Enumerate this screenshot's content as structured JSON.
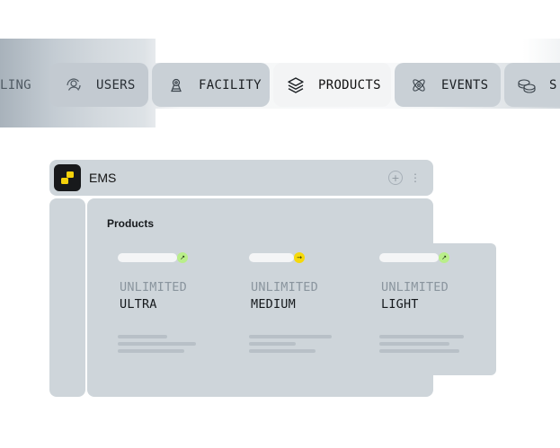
{
  "tabs": [
    {
      "key": "billing",
      "label": "LING",
      "icon": "partial-icon"
    },
    {
      "key": "users",
      "label": "USERS",
      "icon": "users-icon"
    },
    {
      "key": "facility",
      "label": "FACILITY",
      "icon": "facility-icon"
    },
    {
      "key": "products",
      "label": "PRODUCTS",
      "icon": "layers-icon",
      "active": true
    },
    {
      "key": "events",
      "label": "EVENTS",
      "icon": "atom-icon"
    },
    {
      "key": "settings",
      "label": "S",
      "icon": "coins-icon"
    }
  ],
  "app": {
    "title": "EMS",
    "logo": "ems-logo",
    "section_title": "Products"
  },
  "products": [
    {
      "kind": "UNLIMITED",
      "name": "ULTRA",
      "status_color": "#b9ee8a",
      "status_icon": "arrow-up-right-icon"
    },
    {
      "kind": "UNLIMITED",
      "name": "MEDIUM",
      "status_color": "#f6d90a",
      "status_icon": "arrow-right-icon"
    },
    {
      "kind": "UNLIMITED",
      "name": "LIGHT",
      "status_color": "#b9ee8a",
      "status_icon": "arrow-up-right-icon"
    }
  ],
  "colors": {
    "panel": "#ced5da",
    "active_tab": "#f3f4f5",
    "tab": "#c9d0d6",
    "accent_green": "#b9ee8a",
    "accent_yellow": "#f6d90a"
  }
}
